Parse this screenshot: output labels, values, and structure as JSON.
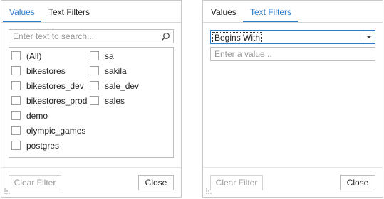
{
  "left_panel": {
    "tabs": [
      {
        "label": "Values",
        "active": true
      },
      {
        "label": "Text Filters",
        "active": false
      }
    ],
    "search": {
      "placeholder": "Enter text to search..."
    },
    "items_col1": [
      "(All)",
      "bikestores",
      "bikestores_dev",
      "bikestores_prod",
      "demo",
      "olympic_games",
      "postgres"
    ],
    "items_col2": [
      "sa",
      "sakila",
      "sale_dev",
      "sales"
    ],
    "buttons": {
      "clear": "Clear Filter",
      "close": "Close"
    }
  },
  "right_panel": {
    "tabs": [
      {
        "label": "Values",
        "active": false
      },
      {
        "label": "Text Filters",
        "active": true
      }
    ],
    "condition": {
      "selected": "Begins With"
    },
    "value_input": {
      "placeholder": "Enter a value..."
    },
    "buttons": {
      "clear": "Clear Filter",
      "close": "Close"
    }
  },
  "colors": {
    "accent": "#2b7bc9",
    "border": "#bdbdbd",
    "disabled_text": "#9a9a9a"
  },
  "icons": [
    "search-icon",
    "dropdown-arrow-icon",
    "resize-grip-icon"
  ]
}
